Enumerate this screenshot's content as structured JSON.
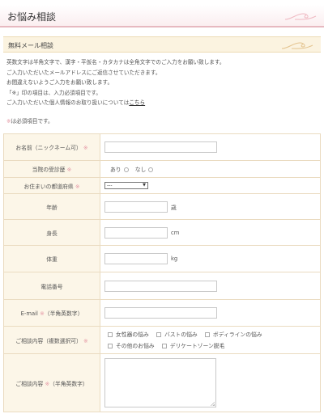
{
  "header": {
    "title": "お悩み相談"
  },
  "section": {
    "title": "無料メール相談"
  },
  "intro": {
    "line1": "英数文字は半角文字で、漢字・平仮名・カタカナは全角文字でのご入力をお願い致します。",
    "line2": "ご入力いただいたメールアドレスにご返信させていただきます。",
    "line3": "お間違えないようご入力をお願い致します。",
    "line4": "「※」印の項目は、入力必須項目です。",
    "line5": "ご入力いただいた個人情報のお取り扱いについては",
    "link": "こちら"
  },
  "required_note": {
    "mark": "※",
    "text": "は必須項目です。"
  },
  "form": {
    "name_label": "お名前（ニックネーム可）",
    "visit_label": "当院の受診歴",
    "visit_yes": "あり",
    "visit_no": "なし",
    "pref_label": "お住まいの都道府県",
    "pref_value": "---",
    "age_label": "年齢",
    "age_unit": "歳",
    "height_label": "身長",
    "height_unit": "cm",
    "weight_label": "体重",
    "weight_unit": "kg",
    "phone_label": "電話番号",
    "email_label": "E-mail",
    "email_note": "（半角英数字）",
    "topics_label": "ご相談内容（複数選択可）",
    "topics": [
      "女性器の悩み",
      "バストの悩み",
      "ボディラインの悩み",
      "その他のお悩み",
      "デリケートゾーン脱毛"
    ],
    "content_label": "ご相談内容",
    "content_note": "（半角英数字）",
    "required_mark": "※"
  },
  "colors": {
    "accent_pink": "#e59aa6",
    "label_bg": "#fcf6e8",
    "border": "#eadbc0",
    "section_bg": "#fbf3e0"
  },
  "icons": {
    "flourish": "swirl-ornament-icon",
    "select_arrow": "triangle-down-icon"
  }
}
